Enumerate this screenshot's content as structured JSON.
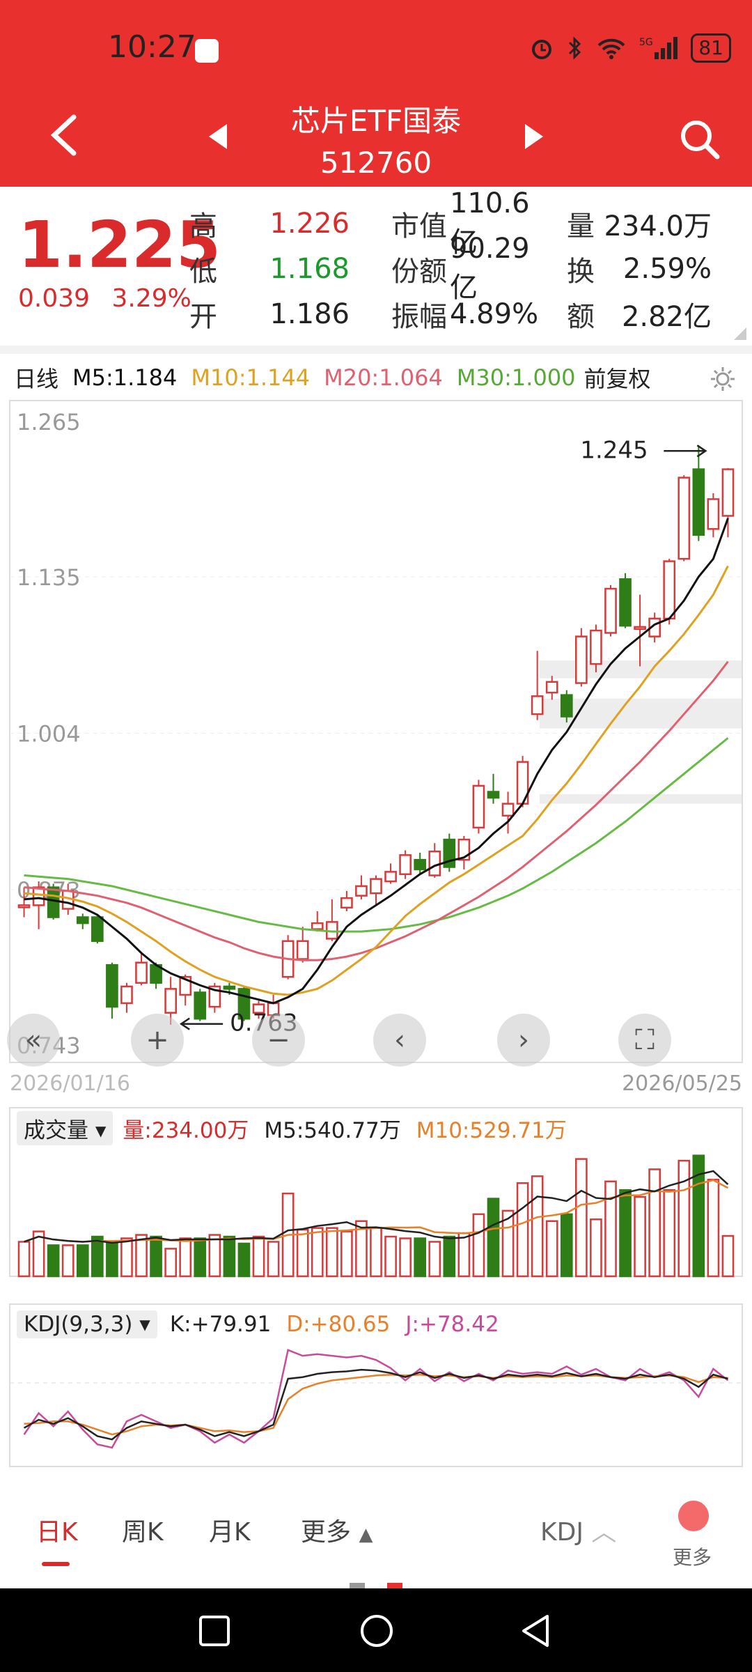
{
  "status": {
    "time": "10:27",
    "battery": "81",
    "network": "5G"
  },
  "nav": {
    "title": "芯片ETF国泰",
    "code": "512760"
  },
  "quote": {
    "price": "1.225",
    "change": "0.039",
    "change_pct": "3.29%",
    "rows": [
      {
        "k1": "高",
        "v1": "1.226",
        "c1": "red",
        "k2": "市值",
        "v2": "110.6亿",
        "k3": "量",
        "v3": "234.0万"
      },
      {
        "k1": "低",
        "v1": "1.168",
        "c1": "green",
        "k2": "份额",
        "v2": "90.29亿",
        "k3": "换",
        "v3": "2.59%"
      },
      {
        "k1": "开",
        "v1": "1.186",
        "c1": "dark",
        "k2": "振幅",
        "v2": "4.89%",
        "k3": "额",
        "v3": "2.82亿"
      }
    ]
  },
  "ma_legend": {
    "period": "日线",
    "m5": "M5:1.184",
    "m10": "M10:1.144",
    "m20": "M20:1.064",
    "m30": "M30:1.000",
    "adjust": "前复权"
  },
  "colors": {
    "up": "#d63a3a",
    "down": "#2e7d16",
    "m5": "#111111",
    "m10": "#e0a020",
    "m20": "#e06070",
    "m30": "#66bb44",
    "accent": "#e8312f"
  },
  "chart_data": {
    "type": "candlestick",
    "y_ticks": [
      "1.265",
      "1.135",
      "1.004",
      "0.873",
      "0.743"
    ],
    "ylim": [
      0.743,
      1.265
    ],
    "start_date": "2026/01/16",
    "end_date": "2026/05/25",
    "max_label": "1.245",
    "min_label": "0.763",
    "candles": [
      {
        "o": 0.86,
        "c": 0.86,
        "h": 0.875,
        "l": 0.85
      },
      {
        "o": 0.86,
        "c": 0.875,
        "h": 0.88,
        "l": 0.84
      },
      {
        "o": 0.875,
        "c": 0.85,
        "h": 0.878,
        "l": 0.848
      },
      {
        "o": 0.857,
        "c": 0.872,
        "h": 0.878,
        "l": 0.852
      },
      {
        "o": 0.85,
        "c": 0.845,
        "h": 0.853,
        "l": 0.84
      },
      {
        "o": 0.85,
        "c": 0.83,
        "h": 0.852,
        "l": 0.828
      },
      {
        "o": 0.81,
        "c": 0.775,
        "h": 0.812,
        "l": 0.765
      },
      {
        "o": 0.778,
        "c": 0.792,
        "h": 0.795,
        "l": 0.77
      },
      {
        "o": 0.795,
        "c": 0.812,
        "h": 0.82,
        "l": 0.793
      },
      {
        "o": 0.81,
        "c": 0.795,
        "h": 0.812,
        "l": 0.79
      },
      {
        "o": 0.77,
        "c": 0.79,
        "h": 0.8,
        "l": 0.76
      },
      {
        "o": 0.785,
        "c": 0.8,
        "h": 0.802,
        "l": 0.776
      },
      {
        "o": 0.787,
        "c": 0.765,
        "h": 0.79,
        "l": 0.763
      },
      {
        "o": 0.775,
        "c": 0.792,
        "h": 0.795,
        "l": 0.77
      },
      {
        "o": 0.792,
        "c": 0.79,
        "h": 0.795,
        "l": 0.785
      },
      {
        "o": 0.79,
        "c": 0.765,
        "h": 0.792,
        "l": 0.763
      },
      {
        "o": 0.77,
        "c": 0.777,
        "h": 0.78,
        "l": 0.765
      },
      {
        "o": 0.768,
        "c": 0.778,
        "h": 0.785,
        "l": 0.765
      },
      {
        "o": 0.8,
        "c": 0.83,
        "h": 0.835,
        "l": 0.798
      },
      {
        "o": 0.815,
        "c": 0.83,
        "h": 0.842,
        "l": 0.812
      },
      {
        "o": 0.84,
        "c": 0.845,
        "h": 0.855,
        "l": 0.838
      },
      {
        "o": 0.832,
        "c": 0.846,
        "h": 0.865,
        "l": 0.83
      },
      {
        "o": 0.858,
        "c": 0.866,
        "h": 0.872,
        "l": 0.855
      },
      {
        "o": 0.868,
        "c": 0.876,
        "h": 0.885,
        "l": 0.865
      },
      {
        "o": 0.87,
        "c": 0.882,
        "h": 0.885,
        "l": 0.86
      },
      {
        "o": 0.88,
        "c": 0.888,
        "h": 0.895,
        "l": 0.878
      },
      {
        "o": 0.886,
        "c": 0.902,
        "h": 0.906,
        "l": 0.882
      },
      {
        "o": 0.898,
        "c": 0.89,
        "h": 0.904,
        "l": 0.886
      },
      {
        "o": 0.885,
        "c": 0.905,
        "h": 0.912,
        "l": 0.883
      },
      {
        "o": 0.915,
        "c": 0.892,
        "h": 0.92,
        "l": 0.888
      },
      {
        "o": 0.898,
        "c": 0.915,
        "h": 0.918,
        "l": 0.89
      },
      {
        "o": 0.925,
        "c": 0.96,
        "h": 0.965,
        "l": 0.92
      },
      {
        "o": 0.955,
        "c": 0.95,
        "h": 0.97,
        "l": 0.945
      },
      {
        "o": 0.935,
        "c": 0.945,
        "h": 0.955,
        "l": 0.92
      },
      {
        "o": 0.945,
        "c": 0.98,
        "h": 0.985,
        "l": 0.942
      },
      {
        "o": 1.02,
        "c": 1.035,
        "h": 1.073,
        "l": 1.015
      },
      {
        "o": 1.038,
        "c": 1.047,
        "h": 1.052,
        "l": 1.032
      },
      {
        "o": 1.036,
        "c": 1.018,
        "h": 1.04,
        "l": 1.013
      },
      {
        "o": 1.046,
        "c": 1.085,
        "h": 1.092,
        "l": 1.043
      },
      {
        "o": 1.062,
        "c": 1.09,
        "h": 1.095,
        "l": 1.055
      },
      {
        "o": 1.088,
        "c": 1.125,
        "h": 1.128,
        "l": 1.085
      },
      {
        "o": 1.133,
        "c": 1.094,
        "h": 1.138,
        "l": 1.092
      },
      {
        "o": 1.093,
        "c": 1.093,
        "h": 1.12,
        "l": 1.06
      },
      {
        "o": 1.085,
        "c": 1.1,
        "h": 1.105,
        "l": 1.08
      },
      {
        "o": 1.1,
        "c": 1.148,
        "h": 1.15,
        "l": 1.095
      },
      {
        "o": 1.15,
        "c": 1.218,
        "h": 1.22,
        "l": 1.148
      },
      {
        "o": 1.225,
        "c": 1.17,
        "h": 1.245,
        "l": 1.165
      },
      {
        "o": 1.175,
        "c": 1.2,
        "h": 1.205,
        "l": 1.168
      },
      {
        "o": 1.186,
        "c": 1.225,
        "h": 1.226,
        "l": 1.168
      }
    ],
    "ma5": [
      0.865,
      0.866,
      0.864,
      0.862,
      0.858,
      0.852,
      0.842,
      0.832,
      0.82,
      0.81,
      0.803,
      0.798,
      0.793,
      0.789,
      0.787,
      0.784,
      0.781,
      0.778,
      0.783,
      0.79,
      0.806,
      0.825,
      0.842,
      0.852,
      0.86,
      0.868,
      0.877,
      0.886,
      0.893,
      0.897,
      0.9,
      0.908,
      0.92,
      0.93,
      0.945,
      0.97,
      0.99,
      1.005,
      1.025,
      1.045,
      1.062,
      1.075,
      1.085,
      1.095,
      1.1,
      1.115,
      1.135,
      1.15,
      1.184
    ],
    "ma10": [
      0.87,
      0.869,
      0.868,
      0.866,
      0.863,
      0.859,
      0.853,
      0.846,
      0.838,
      0.83,
      0.821,
      0.813,
      0.806,
      0.8,
      0.796,
      0.792,
      0.789,
      0.786,
      0.785,
      0.787,
      0.79,
      0.797,
      0.806,
      0.815,
      0.825,
      0.838,
      0.851,
      0.861,
      0.87,
      0.879,
      0.886,
      0.894,
      0.902,
      0.91,
      0.918,
      0.932,
      0.948,
      0.962,
      0.978,
      0.995,
      1.012,
      1.028,
      1.043,
      1.06,
      1.073,
      1.087,
      1.103,
      1.12,
      1.144
    ],
    "ma20": [
      0.875,
      0.874,
      0.873,
      0.872,
      0.87,
      0.868,
      0.865,
      0.862,
      0.858,
      0.853,
      0.848,
      0.843,
      0.838,
      0.833,
      0.829,
      0.824,
      0.82,
      0.817,
      0.815,
      0.814,
      0.814,
      0.815,
      0.817,
      0.82,
      0.824,
      0.829,
      0.834,
      0.84,
      0.846,
      0.853,
      0.86,
      0.867,
      0.875,
      0.883,
      0.892,
      0.902,
      0.912,
      0.922,
      0.933,
      0.944,
      0.956,
      0.968,
      0.98,
      0.993,
      1.006,
      1.02,
      1.034,
      1.048,
      1.064
    ],
    "ma30": [
      0.885,
      0.884,
      0.883,
      0.882,
      0.88,
      0.878,
      0.876,
      0.873,
      0.87,
      0.867,
      0.864,
      0.861,
      0.858,
      0.855,
      0.852,
      0.849,
      0.846,
      0.844,
      0.842,
      0.84,
      0.839,
      0.838,
      0.838,
      0.838,
      0.839,
      0.84,
      0.842,
      0.844,
      0.847,
      0.85,
      0.854,
      0.858,
      0.863,
      0.868,
      0.874,
      0.881,
      0.888,
      0.896,
      0.904,
      0.912,
      0.921,
      0.93,
      0.94,
      0.95,
      0.96,
      0.97,
      0.98,
      0.99,
      1.0
    ],
    "volume": {
      "label": "成交量",
      "vol": "量:234.00万",
      "m5": "M5:540.77万",
      "m10": "M10:529.71万",
      "values": [
        200,
        260,
        180,
        180,
        180,
        230,
        200,
        220,
        240,
        230,
        160,
        220,
        220,
        240,
        230,
        190,
        230,
        200,
        480,
        270,
        280,
        280,
        260,
        320,
        280,
        230,
        220,
        220,
        200,
        230,
        250,
        360,
        450,
        380,
        540,
        580,
        320,
        360,
        680,
        330,
        550,
        500,
        460,
        620,
        500,
        670,
        700,
        560,
        234
      ]
    },
    "kdj": {
      "label": "KDJ(9,3,3)",
      "k": "K:+79.91",
      "d": "D:+80.65",
      "j": "J:+78.42",
      "k_vals": [
        20,
        30,
        25,
        32,
        22,
        10,
        6,
        20,
        28,
        25,
        22,
        24,
        18,
        10,
        15,
        10,
        16,
        24,
        80,
        82,
        86,
        88,
        89,
        91,
        90,
        87,
        82,
        88,
        81,
        86,
        81,
        84,
        80,
        85,
        83,
        85,
        83,
        87,
        83,
        86,
        82,
        80,
        85,
        82,
        85,
        80,
        70,
        85,
        80
      ],
      "d_vals": [
        25,
        26,
        28,
        28,
        24,
        18,
        12,
        16,
        22,
        24,
        23,
        24,
        20,
        16,
        17,
        15,
        16,
        20,
        55,
        68,
        74,
        78,
        80,
        82,
        84,
        85,
        84,
        85,
        83,
        84,
        82,
        83,
        81,
        83,
        82,
        83,
        82,
        84,
        83,
        84,
        82,
        81,
        82,
        83,
        84,
        82,
        76,
        82,
        81
      ],
      "j_vals": [
        12,
        38,
        22,
        40,
        18,
        0,
        -4,
        28,
        36,
        28,
        20,
        24,
        16,
        2,
        12,
        2,
        16,
        32,
        115,
        108,
        110,
        108,
        106,
        108,
        103,
        93,
        78,
        92,
        77,
        88,
        77,
        86,
        78,
        90,
        86,
        88,
        86,
        95,
        85,
        92,
        82,
        78,
        92,
        82,
        88,
        78,
        58,
        92,
        78
      ]
    }
  },
  "controls": [
    "«",
    "+",
    "−",
    "‹",
    "›",
    "⛶"
  ],
  "tabs": [
    {
      "label": "日K",
      "active": true
    },
    {
      "label": "周K"
    },
    {
      "label": "月K"
    },
    {
      "label": "更多"
    }
  ],
  "bottom": {
    "indicator": "KDJ",
    "more": "更多"
  }
}
